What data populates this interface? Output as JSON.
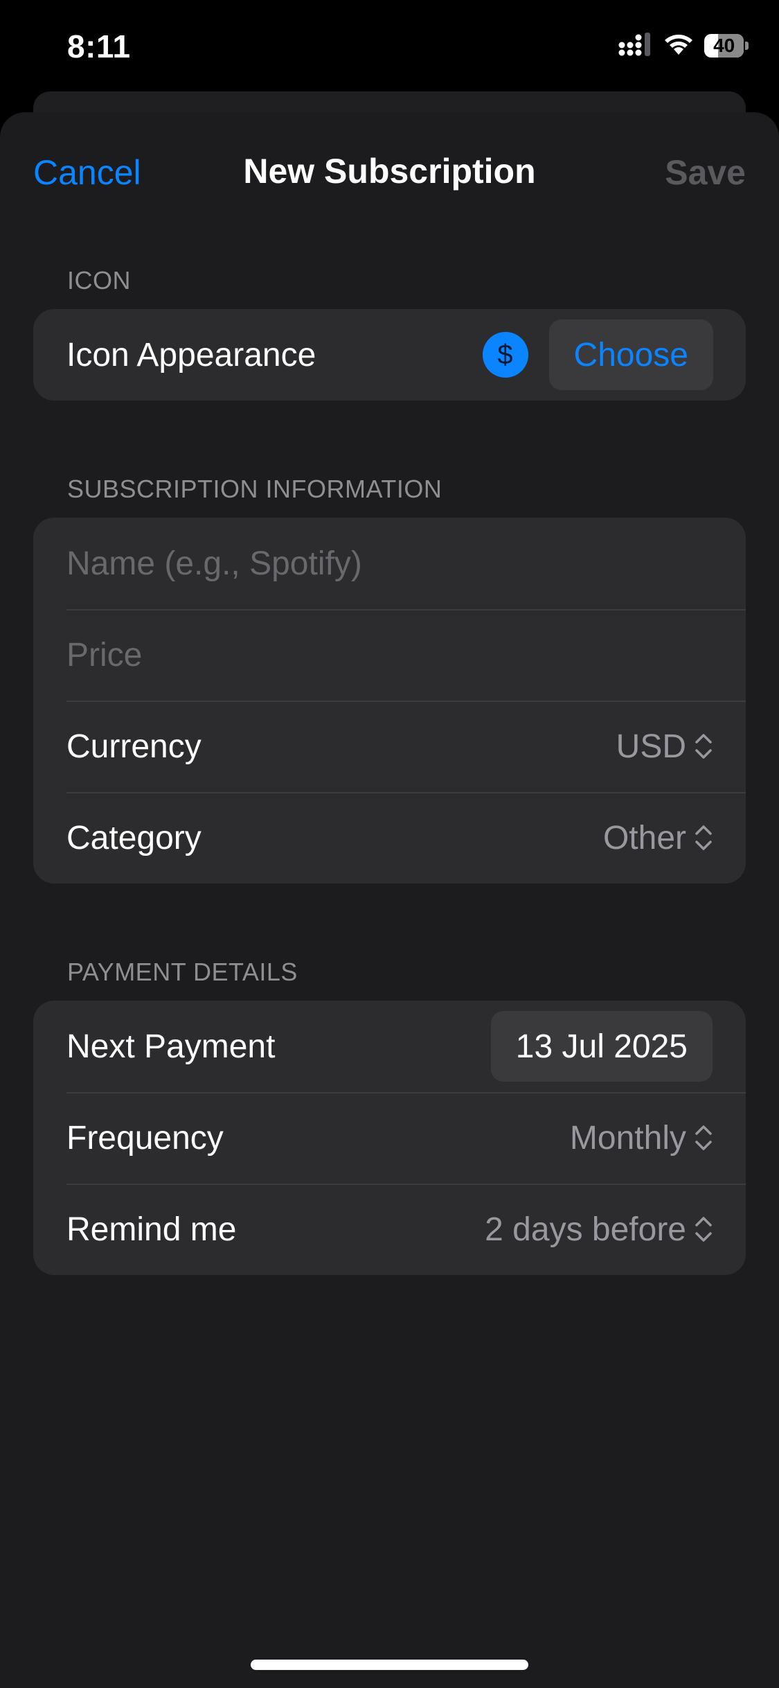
{
  "status_bar": {
    "time": "8:11",
    "battery": "40",
    "icons": [
      "signal-icon",
      "wifi-icon",
      "battery-icon"
    ]
  },
  "nav": {
    "cancel_label": "Cancel",
    "title": "New Subscription",
    "save_label": "Save"
  },
  "icon_section": {
    "header": "ICON",
    "row_label": "Icon Appearance",
    "icon_glyph": "$",
    "icon_name": "dollar-circle-icon",
    "choose_label": "Choose"
  },
  "info_section": {
    "header": "SUBSCRIPTION INFORMATION",
    "name_placeholder": "Name (e.g., Spotify)",
    "price_placeholder": "Price",
    "currency_label": "Currency",
    "currency_value": "USD",
    "category_label": "Category",
    "category_value": "Other"
  },
  "payment_section": {
    "header": "PAYMENT DETAILS",
    "next_payment_label": "Next Payment",
    "next_payment_value": "13 Jul 2025",
    "frequency_label": "Frequency",
    "frequency_value": "Monthly",
    "remind_label": "Remind me",
    "remind_value": "2 days before"
  },
  "colors": {
    "accent": "#0a84ff",
    "sheet_background": "#1c1c1e",
    "group_background": "#2c2c2e",
    "secondary_text": "#98989e",
    "placeholder_text": "#68686d",
    "disabled_text": "#5a5a5e"
  }
}
